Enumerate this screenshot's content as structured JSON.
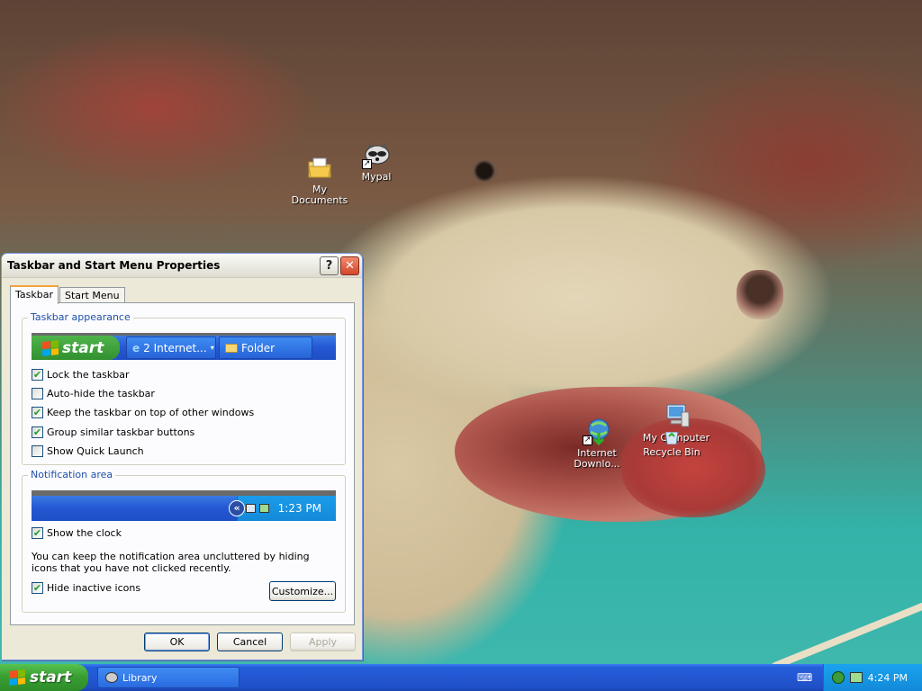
{
  "desktop": {
    "icons": [
      {
        "label": "My Documents"
      },
      {
        "label": "Mypal"
      },
      {
        "label": "Internet Downlo..."
      },
      {
        "label": "My Computer"
      },
      {
        "label": "Recycle Bin"
      }
    ]
  },
  "dialog": {
    "title": "Taskbar and Start Menu Properties",
    "help_glyph": "?",
    "close_glyph": "✕",
    "tabs": [
      "Taskbar",
      "Start Menu"
    ],
    "appearance": {
      "legend": "Taskbar appearance",
      "preview_start": "start",
      "preview_btn1": "2 Internet...",
      "preview_btn2": "Folder",
      "options": [
        {
          "label": "Lock the taskbar",
          "checked": true
        },
        {
          "label": "Auto-hide the taskbar",
          "checked": false
        },
        {
          "label": "Keep the taskbar on top of other windows",
          "checked": true
        },
        {
          "label": "Group similar taskbar buttons",
          "checked": true
        },
        {
          "label": "Show Quick Launch",
          "checked": false
        }
      ]
    },
    "notification": {
      "legend": "Notification area",
      "preview_time": "1:23 PM",
      "show_clock_label": "Show the clock",
      "description": "You can keep the notification area uncluttered by hiding icons that you have not clicked recently.",
      "hide_inactive_label": "Hide inactive icons",
      "customize_label": "Customize..."
    },
    "buttons": {
      "ok": "OK",
      "cancel": "Cancel",
      "apply": "Apply"
    }
  },
  "taskbar": {
    "start_label": "start",
    "task_label": "Library",
    "clock": "4:24 PM"
  }
}
